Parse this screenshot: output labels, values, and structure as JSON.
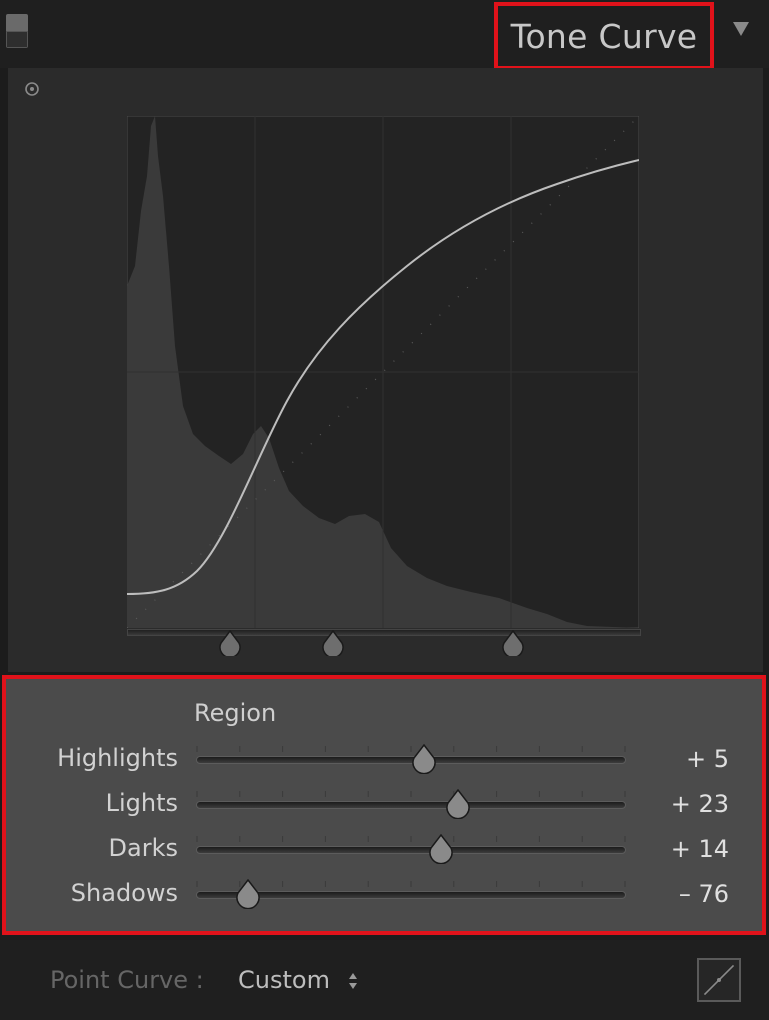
{
  "panel": {
    "title": "Tone Curve",
    "toggle_icon": "panel-switch-icon",
    "collapse_icon": "triangle-down-icon"
  },
  "curve": {
    "target_icon": "target-adjust-icon",
    "split_points": [
      0.2,
      0.4,
      0.75
    ],
    "curve_color": "#bdbdbd",
    "histogram_color": "#3c3c3c"
  },
  "region": {
    "label": "Region",
    "sliders": [
      {
        "label": "Highlights",
        "value": "+ 5",
        "position": 0.53
      },
      {
        "label": "Lights",
        "value": "+ 23",
        "position": 0.61
      },
      {
        "label": "Darks",
        "value": "+ 14",
        "position": 0.57
      },
      {
        "label": "Shadows",
        "value": "– 76",
        "position": 0.12
      }
    ]
  },
  "point_curve": {
    "label": "Point Curve :",
    "value": "Custom",
    "edit_icon": "edit-point-curve-icon"
  },
  "colors": {
    "highlight_border": "#e0121a",
    "panel_bg": "#2b2b2b",
    "region_bg": "#4b4b4b"
  }
}
